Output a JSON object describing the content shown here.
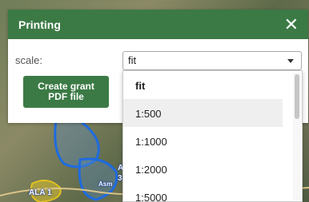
{
  "dialog": {
    "title": "Printing",
    "close_symbol": "✕",
    "scale_label": "scale:",
    "scale_value": "fit",
    "create_button_line1": "Create grant",
    "create_button_line2": "PDF file"
  },
  "dropdown": {
    "options": [
      "fit",
      "1:500",
      "1:1000",
      "1:2000",
      "1:5000"
    ],
    "selected": "fit",
    "highlighted": "1:500"
  },
  "map": {
    "labels": [
      "ALA 1",
      "A",
      "3",
      "Asm"
    ]
  },
  "colors": {
    "header": "#3b7a45",
    "button": "#3b7a45",
    "map_outline": "#1e6be0"
  }
}
